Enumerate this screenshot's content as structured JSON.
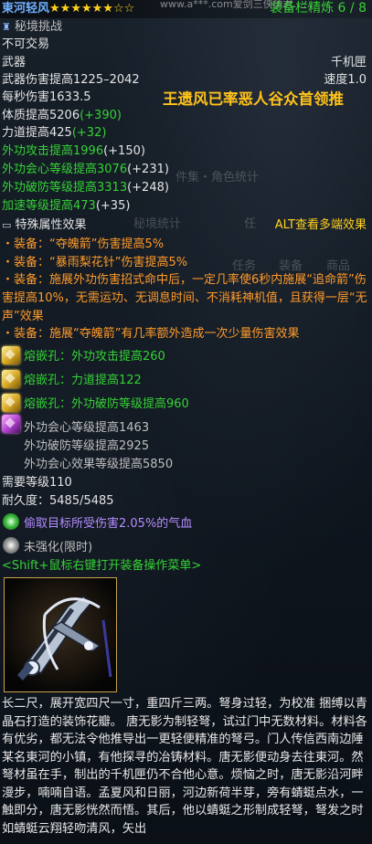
{
  "header": {
    "item_name": "東河轻风",
    "stars": "★★★★★★☆☆",
    "watermark": "www.a***.com爱剑三侠情君……",
    "refine": "装备栏精炼 6 / 8"
  },
  "subtitle": "秘境挑战",
  "binding": "不可交易",
  "slot": "武器",
  "weapon_type": "千机匣",
  "damage": "武器伤害提高1225–2042",
  "speed": "速度1.0",
  "dps": "每秒伤害1633.5",
  "drop_source": "王遗风已率恶人谷众首领推",
  "attrs": [
    {
      "base": "体质提高5206",
      "bonus": "(+390)"
    },
    {
      "base": "力道提高425",
      "bonus": "(+32)"
    },
    {
      "base": "外功攻击提高1996",
      "bonus": "(+150)"
    },
    {
      "base": "外功会心等级提高3076",
      "bonus": "(+231)"
    },
    {
      "base": "外功破防等级提高3313",
      "bonus": "(+248)"
    },
    {
      "base": "加速等级提高473",
      "bonus": "(+35)"
    }
  ],
  "ghost_texts": {
    "g1": "件集・角色统计",
    "g2": "秘境统计",
    "g3": "任",
    "g4": "任务",
    "g5": "装备",
    "g6": "商品"
  },
  "special_header": "特殊属性效果",
  "alt_hint": "ALT查看多端效果",
  "effects": [
    "・装备：“夺魄箭”伤害提高5%",
    "・装备：“暴雨梨花针”伤害提高5%",
    "・装备：施展外功伤害招式命中后，一定几率使6秒内施展“追命箭”伤害提高10%，无需运功、无调息时间、不消耗神机值，且获得一层“无声”效果",
    "・装备：施展“夺魄箭”有几率额外造成一次少量伤害效果"
  ],
  "sockets": [
    "熔嵌孔：外功攻击提高260",
    "熔嵌孔：力道提高122",
    "熔嵌孔：外功破防等级提高960"
  ],
  "enchant": [
    "外功会心等级提高1463",
    "外功破防等级提高2925",
    "外功会心效果等级提高5850"
  ],
  "req_level": "需要等级110",
  "durability": "耐久度：5485/5485",
  "bonus_effect": "偷取目标所受伤害2.05%的气血",
  "strengthen": "未强化(限时)",
  "shift_hint": "<Shift+鼠标右键打开装备操作菜单>",
  "description": "长二尺，展开宽四尺一寸，重四斤三两。弩身过轻，为校准 捆缚以青晶石打造的装饰花瓣。 唐无影为制轻弩，试过门中无数材料。材料各有优劣，都无法令他推导出一更轻便精准的弩弓。门人传信西南边陲某名東河的小镇，有他探寻的冶铸材料。唐无影便动身去往東河。然弩材虽在手，制出的千机匣仍不合他心意。烦恼之时，唐无影沿河畔漫步，喃喃自语。孟夏风和日丽，河边新荷半芽，旁有蜻蜓点水，一触即分，唐无影恍然而悟。其后，他以蜻蜓之形制成轻弩，弩发之时如蜻蜓云翔轻吻清风，矢出",
  "colors": {
    "white": "#e4e4e4",
    "green": "#35d235",
    "orange": "#ff9b2a",
    "yellow": "#ffd21e",
    "blue": "#6fb0ff",
    "purple": "#b48cff"
  }
}
